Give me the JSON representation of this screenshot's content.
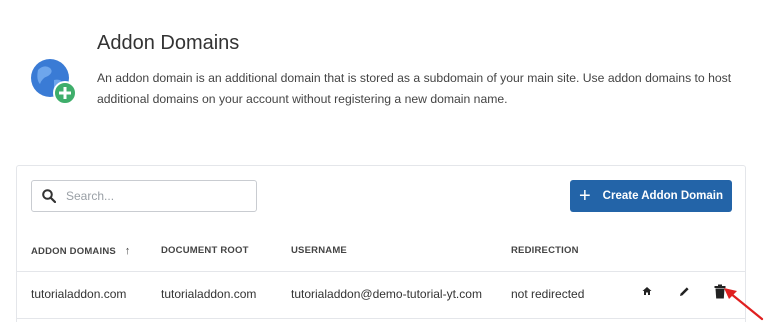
{
  "header": {
    "title": "Addon Domains",
    "description": "An addon domain is an additional domain that is stored as a subdomain of your main site. Use addon domains to host additional domains on your account without registering a new domain name."
  },
  "search": {
    "placeholder": "Search..."
  },
  "toolbar": {
    "create_label": "Create Addon Domain",
    "create_icon": "plus"
  },
  "table": {
    "columns": [
      "ADDON DOMAINS",
      "DOCUMENT ROOT",
      "USERNAME",
      "REDIRECTION"
    ],
    "sort_indicator": "↑",
    "rows": [
      {
        "domain": "tutorialaddon.com",
        "document_root": "tutorialaddon.com",
        "username": "tutorialaddon@demo-tutorial-yt.com",
        "redirection": "not redirected"
      }
    ]
  },
  "icons": [
    "globe-plus-icon",
    "search-icon",
    "home-icon",
    "pencil-icon",
    "trash-icon",
    "red-arrow-annotation"
  ],
  "colors": {
    "accent": "#2364a8",
    "globe_blue": "#3a7bd5",
    "badge_green": "#3fae6b",
    "annotation_red": "#e02020"
  }
}
